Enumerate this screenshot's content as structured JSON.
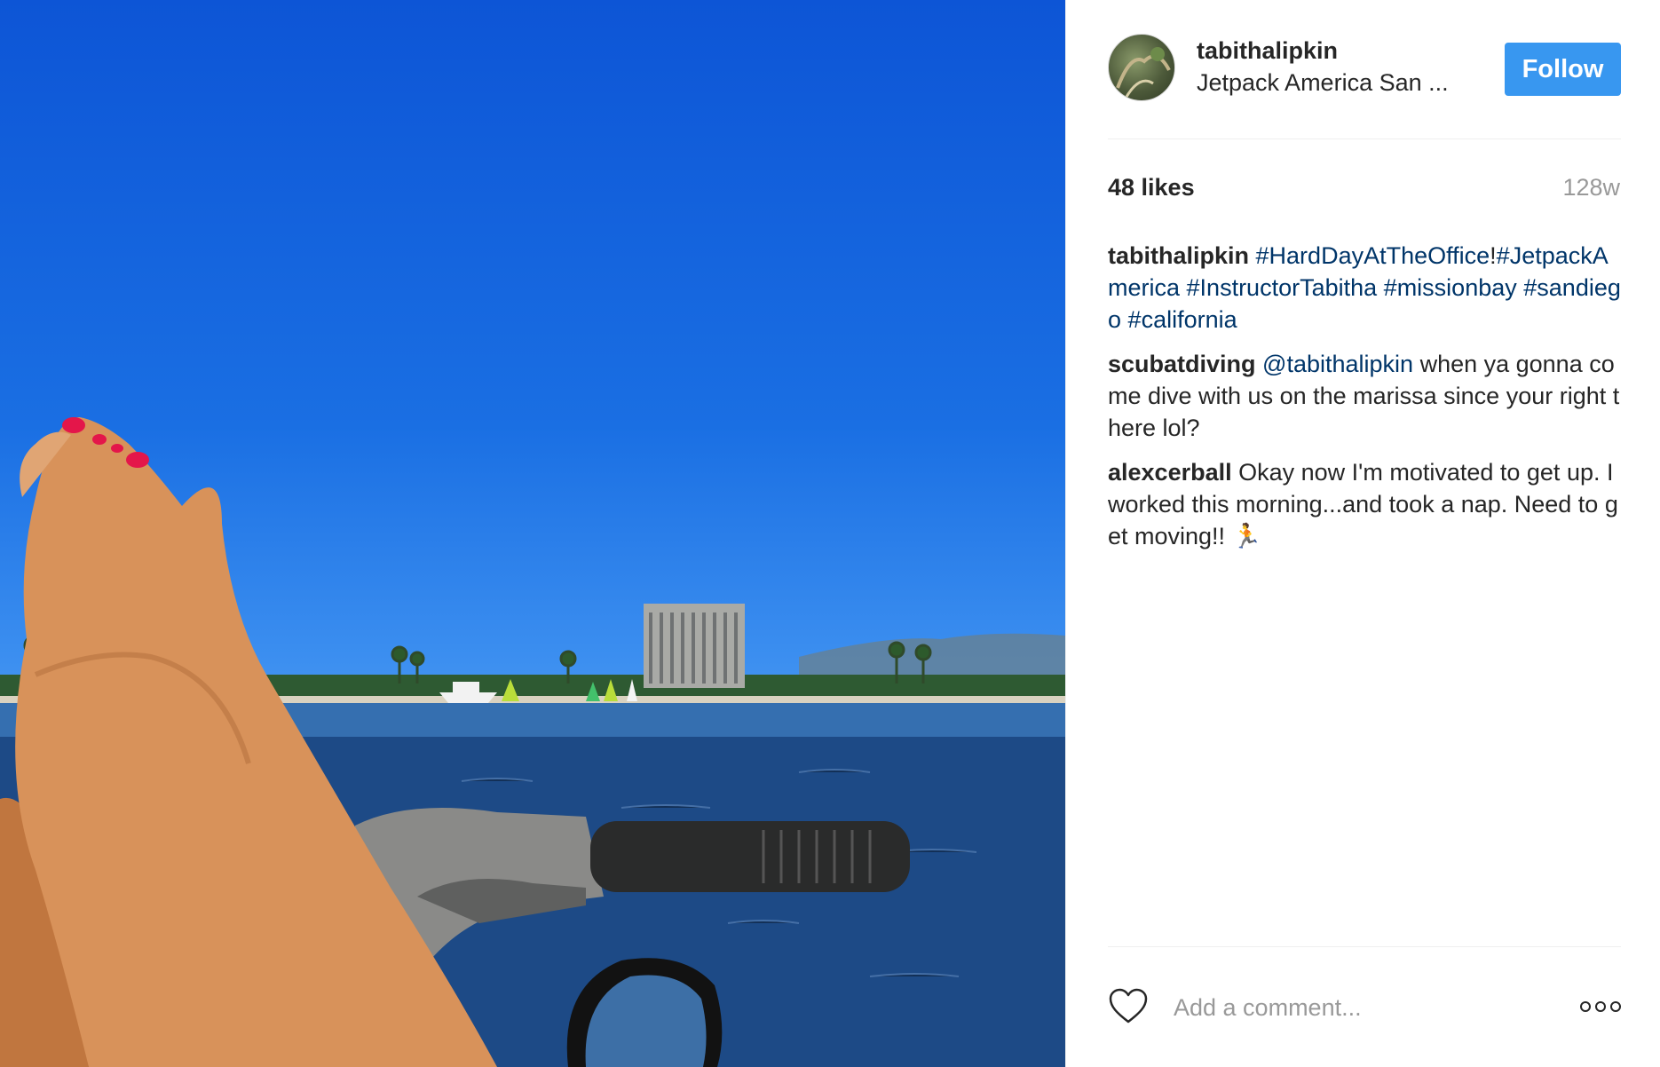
{
  "header": {
    "username": "tabithalipkin",
    "location": "Jetpack America San ...",
    "follow_label": "Follow"
  },
  "stats": {
    "likes": "48 likes",
    "age": "128w"
  },
  "comments": [
    {
      "author": "tabithalipkin",
      "segments": [
        {
          "type": "tag",
          "text": "#HardDayAtTheOffice"
        },
        {
          "type": "text",
          "text": "!"
        },
        {
          "type": "tag",
          "text": "#JetpackAmerica"
        },
        {
          "type": "text",
          "text": " "
        },
        {
          "type": "tag",
          "text": "#InstructorTabitha"
        },
        {
          "type": "text",
          "text": " "
        },
        {
          "type": "tag",
          "text": "#missionbay"
        },
        {
          "type": "text",
          "text": " "
        },
        {
          "type": "tag",
          "text": "#sandiego"
        },
        {
          "type": "text",
          "text": " "
        },
        {
          "type": "tag",
          "text": "#california"
        }
      ]
    },
    {
      "author": "scubatdiving",
      "segments": [
        {
          "type": "tag",
          "text": "@tabithalipkin"
        },
        {
          "type": "text",
          "text": " when ya gonna come dive with us on the marissa since your right there lol?"
        }
      ]
    },
    {
      "author": "alexcerball",
      "segments": [
        {
          "type": "text",
          "text": "Okay now I'm motivated to get up. I worked this morning...and took a nap. Need to get moving!! 🏃"
        }
      ]
    }
  ],
  "footer": {
    "comment_placeholder": "Add a comment...",
    "like_icon": "heart-icon",
    "more_icon": "more-options-icon"
  },
  "colors": {
    "follow_bg": "#3897f0",
    "hashtag": "#003569",
    "muted": "#999999"
  }
}
